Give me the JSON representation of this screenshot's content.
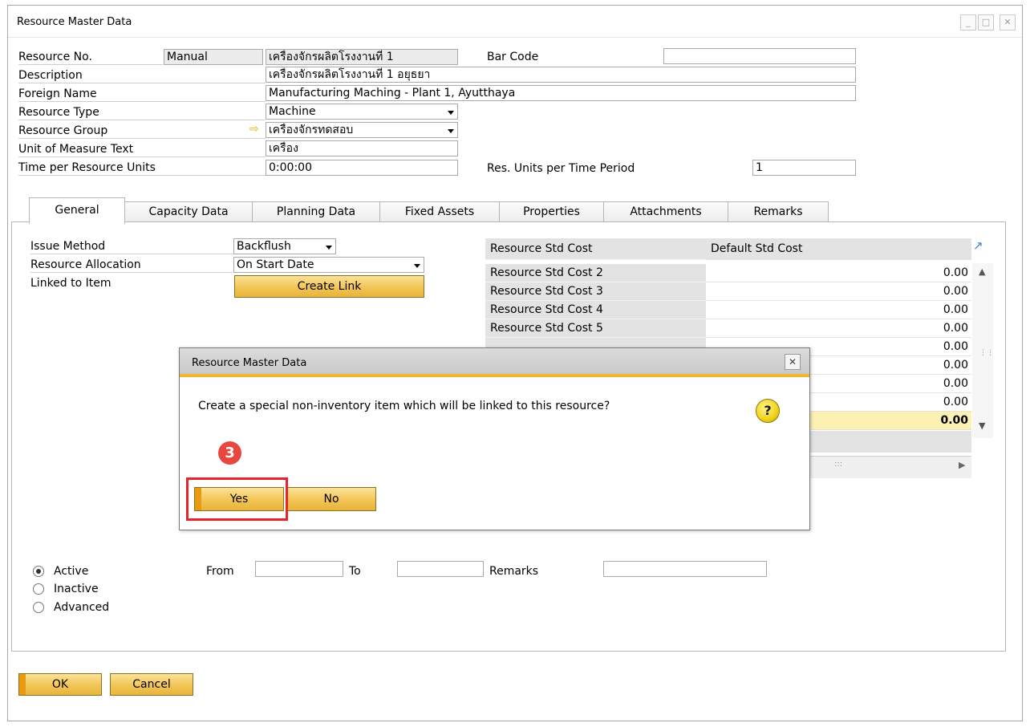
{
  "window": {
    "title": "Resource Master Data",
    "controls": {
      "minimize": "_",
      "maximize": "□",
      "close": "✕"
    }
  },
  "header": {
    "resource_no": {
      "label": "Resource No.",
      "series": "Manual",
      "value": "เครื่องจักรผลิตโรงงานที่ 1"
    },
    "bar_code": {
      "label": "Bar Code",
      "value": ""
    },
    "description": {
      "label": "Description",
      "value": "เครื่องจักรผลิตโรงงานที่ 1 อยุธยา"
    },
    "foreign_name": {
      "label": "Foreign Name",
      "value": "Manufacturing Maching - Plant 1, Ayutthaya"
    },
    "resource_type": {
      "label": "Resource Type",
      "value": "Machine"
    },
    "resource_group": {
      "label": "Resource Group",
      "value": "เครื่องจักรทดสอบ"
    },
    "uom_text": {
      "label": "Unit of Measure Text",
      "value": "เครื่อง"
    },
    "time_per_unit": {
      "label": "Time per Resource Units",
      "value": "0:00:00"
    },
    "res_units_per_period": {
      "label": "Res. Units per Time Period",
      "value": "1"
    }
  },
  "tabs": [
    {
      "label": "General",
      "active": true
    },
    {
      "label": "Capacity Data"
    },
    {
      "label": "Planning Data"
    },
    {
      "label": "Fixed Assets"
    },
    {
      "label": "Properties"
    },
    {
      "label": "Attachments"
    },
    {
      "label": "Remarks"
    }
  ],
  "general": {
    "issue_method": {
      "label": "Issue Method",
      "value": "Backflush"
    },
    "resource_allocation": {
      "label": "Resource Allocation",
      "value": "On Start Date"
    },
    "linked_to_item": {
      "label": "Linked to Item",
      "button": "Create Link"
    }
  },
  "cost_grid": {
    "headers": [
      "Resource Std Cost",
      "Default Std Cost"
    ],
    "rows": [
      {
        "name": "Resource Std Cost 2",
        "value": "0.00"
      },
      {
        "name": "Resource Std Cost 3",
        "value": "0.00"
      },
      {
        "name": "Resource Std Cost 4",
        "value": "0.00"
      },
      {
        "name": "Resource Std Cost 5",
        "value": "0.00"
      },
      {
        "name": "",
        "value": "0.00"
      },
      {
        "name": "",
        "value": "0.00"
      },
      {
        "name": "",
        "value": "0.00"
      },
      {
        "name": "",
        "value": "0.00"
      },
      {
        "name": "",
        "value": "0.00"
      }
    ]
  },
  "status": {
    "options": [
      {
        "label": "Active",
        "selected": true
      },
      {
        "label": "Inactive",
        "selected": false
      },
      {
        "label": "Advanced",
        "selected": false
      }
    ],
    "from_label": "From",
    "to_label": "To",
    "remarks_label": "Remarks",
    "from_value": "",
    "to_value": "",
    "remarks_value": ""
  },
  "footer": {
    "ok": "OK",
    "cancel": "Cancel"
  },
  "dialog": {
    "title": "Resource Master Data",
    "message": "Create a special non-inventory item which will be linked to this resource?",
    "yes": "Yes",
    "no": "No",
    "icon": "question-icon"
  },
  "annotation": {
    "step_number": "3",
    "highlight_color": "#e8232a"
  },
  "colors": {
    "accent_gold": "#f2c554",
    "dialog_border": "#f2b62e"
  }
}
